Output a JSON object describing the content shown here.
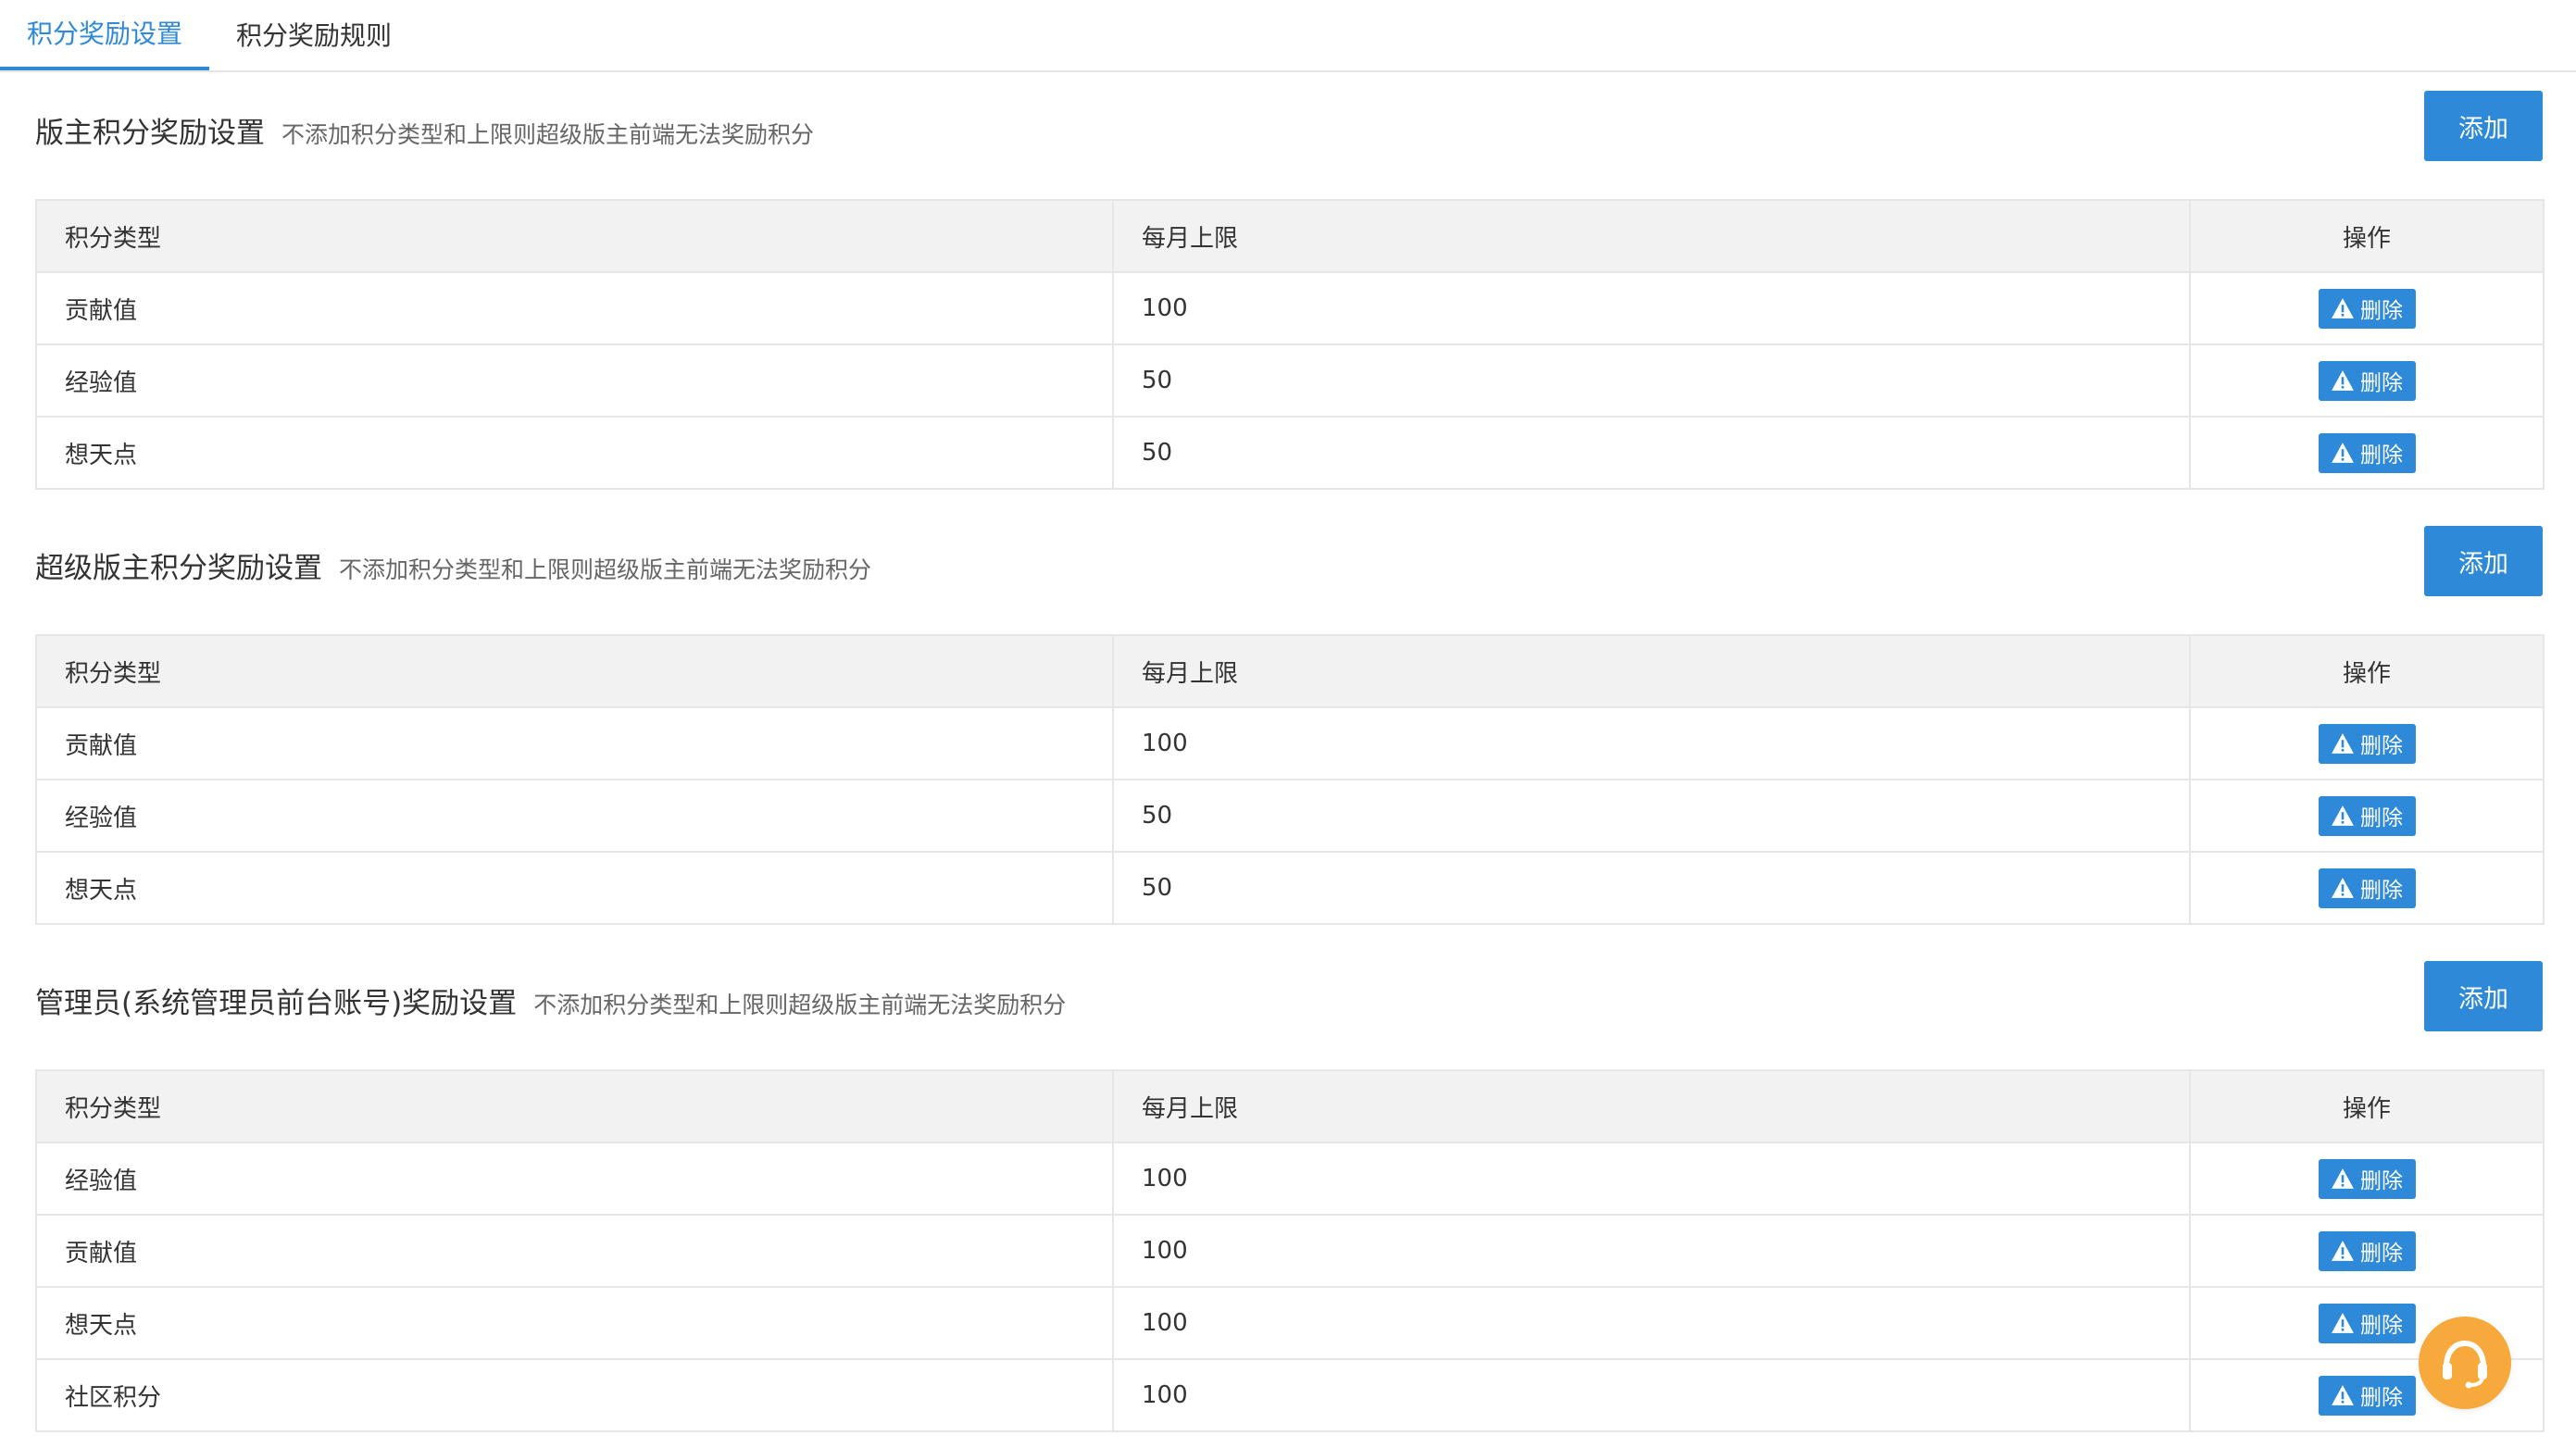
{
  "tabs": [
    {
      "label": "积分奖励设置",
      "active": true
    },
    {
      "label": "积分奖励规则",
      "active": false
    }
  ],
  "colors": {
    "accent": "#2e8ad8",
    "support": "#f7a93c"
  },
  "sections": [
    {
      "title": "版主积分奖励设置",
      "tip": "不添加积分类型和上限则超级版主前端无法奖励积分",
      "add_label": "添加",
      "headers": [
        "积分类型",
        "每月上限",
        "操作"
      ],
      "rows": [
        {
          "type": "贡献值",
          "limit": "100",
          "action": "删除"
        },
        {
          "type": "经验值",
          "limit": "50",
          "action": "删除"
        },
        {
          "type": "想天点",
          "limit": "50",
          "action": "删除"
        }
      ]
    },
    {
      "title": "超级版主积分奖励设置",
      "tip": "不添加积分类型和上限则超级版主前端无法奖励积分",
      "add_label": "添加",
      "headers": [
        "积分类型",
        "每月上限",
        "操作"
      ],
      "rows": [
        {
          "type": "贡献值",
          "limit": "100",
          "action": "删除"
        },
        {
          "type": "经验值",
          "limit": "50",
          "action": "删除"
        },
        {
          "type": "想天点",
          "limit": "50",
          "action": "删除"
        }
      ]
    },
    {
      "title": "管理员(系统管理员前台账号)奖励设置",
      "tip": "不添加积分类型和上限则超级版主前端无法奖励积分",
      "add_label": "添加",
      "headers": [
        "积分类型",
        "每月上限",
        "操作"
      ],
      "rows": [
        {
          "type": "经验值",
          "limit": "100",
          "action": "删除"
        },
        {
          "type": "贡献值",
          "limit": "100",
          "action": "删除"
        },
        {
          "type": "想天点",
          "limit": "100",
          "action": "删除"
        },
        {
          "type": "社区积分",
          "limit": "100",
          "action": "删除"
        }
      ]
    }
  ],
  "icons": {
    "delete": "warning-icon",
    "support": "headset-icon"
  }
}
